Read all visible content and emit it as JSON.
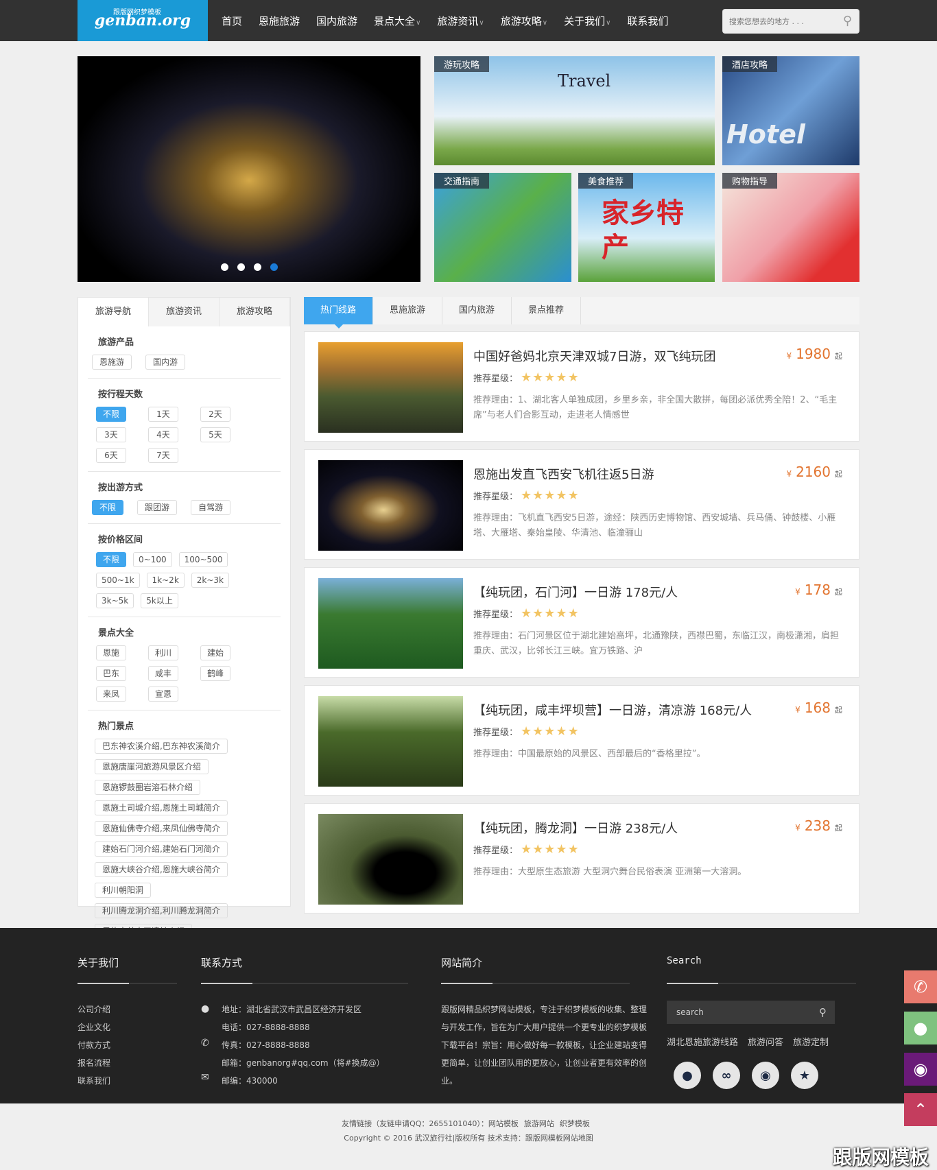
{
  "header": {
    "logo_text": "genban.org",
    "logo_sub": "跟版网织梦模板",
    "nav": [
      {
        "label": "首页"
      },
      {
        "label": "恩施旅游"
      },
      {
        "label": "国内旅游"
      },
      {
        "label": "景点大全",
        "dropdown": true
      },
      {
        "label": "旅游资讯",
        "dropdown": true
      },
      {
        "label": "旅游攻略",
        "dropdown": true
      },
      {
        "label": "关于我们",
        "dropdown": true
      },
      {
        "label": "联系我们"
      }
    ],
    "search_placeholder": "搜索您想去的地方 . . ."
  },
  "banner": {
    "dots": 4,
    "active_dot": 4,
    "tiles": [
      {
        "label": "游玩攻略",
        "image_text": "Travel"
      },
      {
        "label": "酒店攻略",
        "image_text": "Hotel"
      },
      {
        "label": "交通指南"
      },
      {
        "label": "美食推荐",
        "image_text": "家乡特产"
      },
      {
        "label": "购物指导"
      }
    ]
  },
  "sidebar": {
    "tabs": [
      "旅游导航",
      "旅游资讯",
      "旅游攻略"
    ],
    "active_tab": 0,
    "sections": [
      {
        "title": "旅游产品",
        "tags": [
          "恩施游",
          "国内游"
        ]
      },
      {
        "title": "按行程天数",
        "tags": [
          "不限",
          "1天",
          "2天",
          "3天",
          "4天",
          "5天",
          "6天",
          "7天"
        ],
        "active": 0
      },
      {
        "title": "按出游方式",
        "tags": [
          "不限",
          "跟团游",
          "自驾游"
        ],
        "active": 0
      },
      {
        "title": "按价格区间",
        "tags": [
          "不限",
          "0~100",
          "100~500",
          "500~1k",
          "1k~2k",
          "2k~3k",
          "3k~5k",
          "5k以上"
        ],
        "active": 0
      },
      {
        "title": "景点大全",
        "tags": [
          "恩施",
          "利川",
          "建始",
          "巴东",
          "咸丰",
          "鹤峰",
          "来凤",
          "宣恩"
        ]
      },
      {
        "title": "热门景点",
        "tags": [
          "巴东神农溪介绍,巴东神农溪简介",
          "恩施唐崖河旅游风景区介绍",
          "恩施锣鼓圈岩溶石林介绍",
          "恩施土司城介绍,恩施土司城简介",
          "恩施仙佛寺介绍,来凤仙佛寺简介",
          "建始石门河介绍,建始石门河简介",
          "恩施大峡谷介绍,恩施大峡谷简介",
          "利川朝阳洞",
          "利川腾龙洞介绍,利川腾龙洞简介",
          "恩施容美土司遗址介绍"
        ]
      }
    ]
  },
  "main": {
    "tabs": [
      "热门线路",
      "恩施旅游",
      "国内旅游",
      "景点推荐"
    ],
    "active_tab": 0,
    "star_label": "推荐星级：",
    "currency": "¥",
    "price_suffix": "起",
    "stars": 5,
    "items": [
      {
        "title": "中国好爸妈北京天津双城7日游，双飞纯玩团",
        "price": "1980",
        "reason": "推荐理由：1、湖北客人单独成团，乡里乡亲，非全国大散拼，每团必派优秀全陪！2、“毛主席”与老人们合影互动，走进老人情感世"
      },
      {
        "title": "恩施出发直飞西安飞机往返5日游",
        "price": "2160",
        "reason": "推荐理由：飞机直飞西安5日游，途经：陕西历史博物馆、西安城墙、兵马俑、钟鼓楼、小雁塔、大雁塔、秦始皇陵、华清池、临潼骊山"
      },
      {
        "title": "【纯玩团，石门河】一日游 178元/人",
        "price": "178",
        "reason": "推荐理由：石门河景区位于湖北建始高坪，北通豫陕，西襟巴蜀，东临江汉，南极潇湘，肩担重庆、武汉，比邻长江三峡。宜万铁路、沪"
      },
      {
        "title": "【纯玩团，咸丰坪坝营】一日游，清凉游 168元/人",
        "price": "168",
        "reason": "推荐理由：中国最原始的风景区、西部最后的“香格里拉”。"
      },
      {
        "title": "【纯玩团，腾龙洞】一日游 238元/人",
        "price": "238",
        "reason": "推荐理由：大型原生态旅游 大型洞穴舞台民俗表演 亚洲第一大溶洞。"
      }
    ]
  },
  "footer": {
    "about": {
      "title": "关于我们",
      "links": [
        "公司介绍",
        "企业文化",
        "付款方式",
        "报名流程",
        "联系我们"
      ]
    },
    "contact": {
      "title": "联系方式",
      "lines": [
        "地址：湖北省武汉市武昌区经济开发区",
        "电话：027-8888-8888",
        "传真：027-8888-8888",
        "邮箱：genbanorg#qq.com（将#换成@）",
        "邮编：430000"
      ]
    },
    "intro": {
      "title": "网站简介",
      "text": "跟版网精品织梦网站模板，专注于织梦模板的收集、整理与开发工作，旨在为广大用户提供一个更专业的织梦模板下载平台！宗旨：用心做好每一款模板，让企业建站变得更简单，让创业团队用的更放心，让创业者更有效率的创业。"
    },
    "search": {
      "title": "Search",
      "placeholder": "search",
      "links": [
        "湖北恩施旅游线路",
        "旅游问答",
        "旅游定制"
      ],
      "social": [
        "qq-icon",
        "weibo-icon",
        "wechat-icon",
        "qzone-icon"
      ]
    },
    "friend_links": "友情链接（友链申请QQ：2655101040）：",
    "friend_items": [
      "网站模板",
      "旅游网站",
      "织梦模板"
    ],
    "copyright": "Copyright © 2016 武汉旅行社|版权所有 技术支持：跟版网模板网站地图"
  },
  "float": {
    "colors": {
      "phone": "#e87a6e",
      "qq": "#7fc27f",
      "wechat": "#6a1a78",
      "top": "#c43d5e"
    }
  },
  "watermark": "跟版网模板",
  "colors": {
    "accent": "#3fa6ee",
    "price": "#e2742f",
    "header": "#323232",
    "logo_bg": "#1a9ad6",
    "star": "#f2c463"
  }
}
